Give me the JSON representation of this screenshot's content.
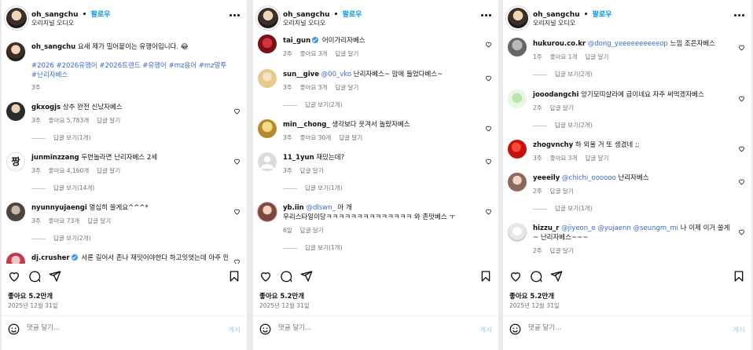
{
  "post": {
    "username": "oh_sangchu",
    "dot": "•",
    "follow_label": "팔로우",
    "audio": "오리지널 오디오",
    "caption_text": "요새 제가 밀어붙이는 유행어입니다. 😂",
    "hashtags": "#2026 #2026유행어 #2026트렌드 #유행어 #mz용어 #mz말투 #난리자베스",
    "caption_time": "3주",
    "likes": "좋아요 5.2만개",
    "date": "2025년 12월 31일",
    "comment_placeholder": "댓글 달기...",
    "post_label": "게시"
  },
  "panels": [
    {
      "comments": [
        {
          "user": "gkxogjs",
          "text": "상추 완전 신났자베스",
          "time": "3주",
          "likes": "좋아요 5,783개",
          "reply": "답글 달기",
          "view_replies": "답글 보기(1개)"
        },
        {
          "user": "junminzzang",
          "text": "두번놀라면 난리자베스 2세",
          "time": "3주",
          "likes": "좋아요 4,160개",
          "reply": "답글 달기",
          "view_replies": "답글 보기(14개)"
        },
        {
          "user": "nyunnyujaengi",
          "text": "열심히 쓸게요^^^*",
          "time": "3주",
          "likes": "좋아요 73개",
          "reply": "답글 달기",
          "view_replies": "답글 보기(2개)"
        },
        {
          "user": "dj.crusher",
          "text": "서론 길어서 존나 재밋어야한다 하고잇엇는데 아주 만"
        }
      ]
    },
    {
      "comments": [
        {
          "user": "tai_gun",
          "text": "어이가리자베스",
          "time": "2주",
          "likes": "좋아요 3개",
          "reply": "답글 달기"
        },
        {
          "user": "sun__give",
          "mention": "@00_vko",
          "text": "난리자베스~ 맘에 들었다베스~",
          "time": "3주",
          "likes": "좋아요 3개",
          "reply": "답글 달기",
          "view_replies": "답글 보기(2개)"
        },
        {
          "user": "min__chong_",
          "text": "생각보다 웃겨서 놀랐자베스",
          "time": "3주",
          "likes": "좋아요 30개",
          "reply": "답글 달기"
        },
        {
          "user": "11_1yun",
          "text": "재밌는데?",
          "time": "3주",
          "reply": "답글 달기",
          "view_replies": "답글 보기(1개)"
        },
        {
          "user": "yb.iin",
          "mention": "@dlswn_",
          "text": "아 개 우리스타일이당ㅋㅋㅋㅋㅋㅋㅋㅋㅋㅋㅋㅋㅋㅋ 와 존맛베스 ㅜ",
          "time": "6일",
          "reply": "답글 달기",
          "view_replies": "답글 보기(1개)"
        }
      ]
    },
    {
      "comments": [
        {
          "user": "hukurou.co.kr",
          "mention": "@dong_yeeeeeeeeeeop",
          "text": "느낌 조은자베스",
          "time": "1주",
          "likes": "좋아요 1개",
          "reply": "답글 달기",
          "view_replies": "답글 보기(2개)"
        },
        {
          "user": "jooodangchi",
          "text": "앙기모띠샬라에 급이네요 자주 써먹겠자베스",
          "time": "2주",
          "reply": "답글 달기",
          "view_replies": "답글 보기(2개)"
        },
        {
          "user": "zhogvnchy",
          "text": "하 외울 거 또 생겼네 ;;",
          "time": "3주",
          "likes": "좋아요 3개",
          "reply": "답글 달기"
        },
        {
          "user": "yeeeily",
          "mention": "@chichi_oooooo",
          "text": "난리자베스",
          "time": "2주",
          "reply": "답글 달기",
          "view_replies": "답글 보기(1개)"
        },
        {
          "user": "hizzu_r",
          "mention": "@jiyeon_e @yujaenn @seungm_mi",
          "text": "나 이제 이거 쓸게 ~ 난리자베스~~~",
          "time": "2주",
          "reply": "답글 달기"
        }
      ]
    }
  ],
  "icons": {
    "heart": "heart-icon",
    "comment": "comment-icon",
    "share": "share-icon",
    "bookmark": "bookmark-icon",
    "emoji": "emoji-icon",
    "more": "more-icon",
    "verified": "verified-badge-icon"
  },
  "colors": {
    "accent": "#0095f6",
    "mention": "#3c6ad6",
    "post_disabled": "#a3c6f4",
    "meta": "#737373"
  }
}
